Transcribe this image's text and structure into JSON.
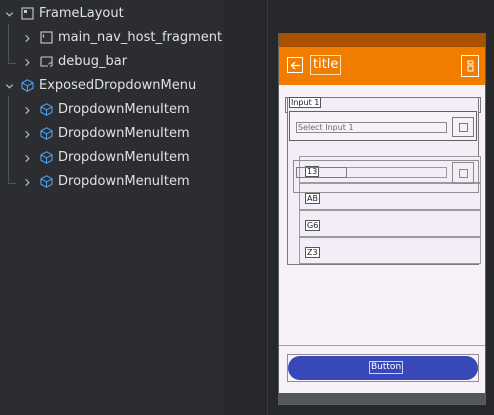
{
  "tree": {
    "items": [
      {
        "label": "FrameLayout",
        "icon": "frame-layout-icon",
        "expanded": true
      },
      {
        "label": "main_nav_host_fragment",
        "icon": "fragment-icon",
        "expanded": false
      },
      {
        "label": "debug_bar",
        "icon": "compose-view-icon",
        "expanded": false
      },
      {
        "label": "ExposedDropdownMenu",
        "icon": "composable-icon",
        "expanded": true
      },
      {
        "label": "DropdownMenuItem",
        "icon": "composable-icon",
        "expanded": false
      },
      {
        "label": "DropdownMenuItem",
        "icon": "composable-icon",
        "expanded": false
      },
      {
        "label": "DropdownMenuItem",
        "icon": "composable-icon",
        "expanded": false
      },
      {
        "label": "DropdownMenuItem",
        "icon": "composable-icon",
        "expanded": false
      }
    ]
  },
  "preview": {
    "app_title": "title",
    "input_label": "Input 1",
    "input_placeholder": "Select Input 1",
    "menu_items": [
      "13",
      "AB",
      "G6",
      "Z3"
    ],
    "button_label": "Button",
    "colors": {
      "app_bar": "#f07c00",
      "status_bar": "#a85200",
      "button": "#3848b8",
      "surface": "#f7f2fa"
    }
  }
}
